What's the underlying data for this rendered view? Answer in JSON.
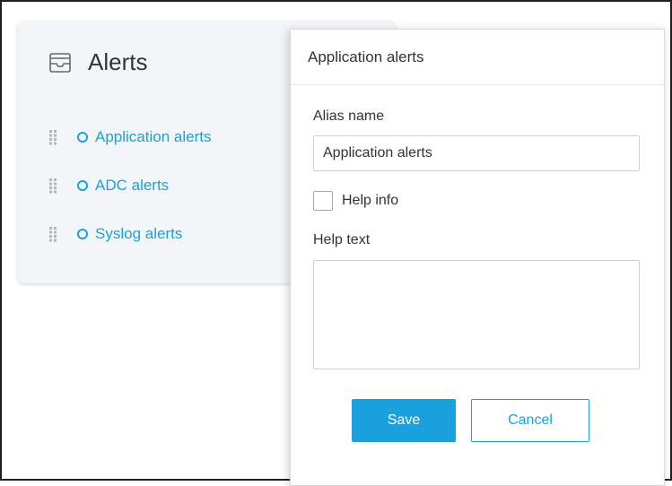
{
  "alerts_card": {
    "icon": "inbox-icon",
    "title": "Alerts",
    "items": [
      {
        "label": "Application alerts",
        "icon": "circle-icon",
        "handle": "drag-handle-icon"
      },
      {
        "label": "ADC alerts",
        "icon": "circle-icon",
        "handle": "drag-handle-icon"
      },
      {
        "label": "Syslog alerts",
        "icon": "circle-icon",
        "handle": "drag-handle-icon"
      }
    ]
  },
  "panel": {
    "title": "Application alerts",
    "alias_label": "Alias name",
    "alias_value": "Application alerts",
    "help_info_label": "Help info",
    "help_info_checked": false,
    "help_text_label": "Help text",
    "help_text_value": "",
    "save_label": "Save",
    "cancel_label": "Cancel"
  },
  "colors": {
    "accent": "#1aa0dc",
    "card_bg": "#f3f6f8",
    "text": "#333333"
  }
}
